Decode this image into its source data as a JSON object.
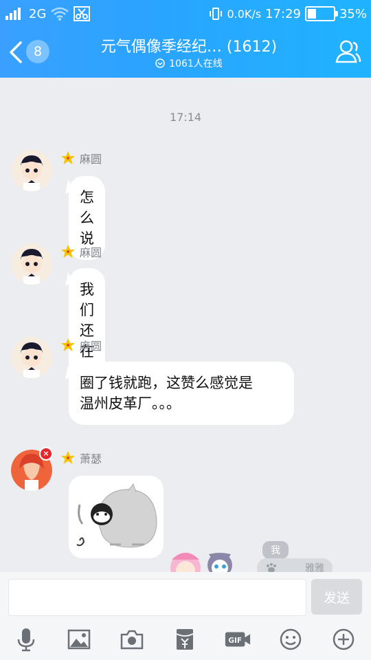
{
  "status_bar": {
    "network": "2G",
    "speed": "0.0K/s",
    "time": "17:29",
    "battery": "35%",
    "battery_level": 0.35
  },
  "header": {
    "unread_count": "8",
    "title": "元气偶像季经纪… (1612)",
    "online": "1061人在线"
  },
  "chat": {
    "timestamp": "17:14",
    "messages": [
      {
        "sender": "麻圆",
        "text": "怎么说"
      },
      {
        "sender": "麻圆",
        "text": "我们还在呀"
      },
      {
        "sender": "麻圆",
        "text_line1": "圈了钱就跑，这赞么感觉是",
        "text_line2": "温州皮革厂。。。"
      },
      {
        "sender": "萧瑟",
        "type": "sticker"
      }
    ]
  },
  "popup": {
    "me_label": "我",
    "name_label": "雅雅"
  },
  "input": {
    "send_label": "发送"
  },
  "toolbar": {
    "icons": [
      "microphone-icon",
      "image-icon",
      "camera-icon",
      "red-packet-icon",
      "gif-icon",
      "emoji-icon",
      "plus-icon"
    ]
  },
  "colors": {
    "header_start": "#3aa0ff",
    "header_end": "#1fb3ff",
    "chat_bg": "#ebedf1",
    "badge_red": "#e5262e",
    "star": "#f5c400"
  }
}
